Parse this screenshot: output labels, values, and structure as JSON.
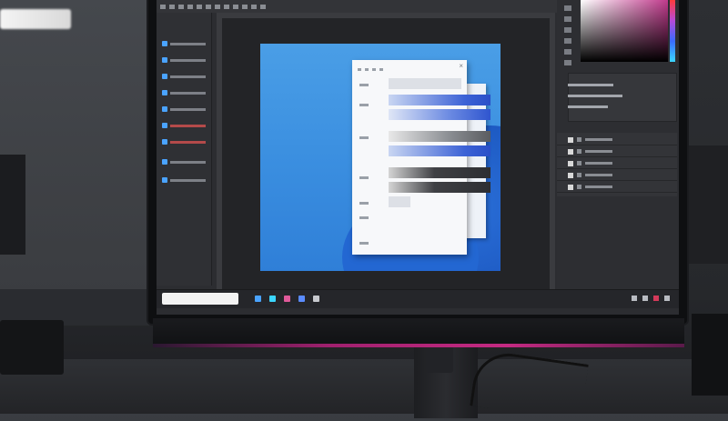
{
  "scene": {
    "description_tags": [
      "monitor",
      "photo-editor",
      "dark-room"
    ],
    "accent_colors": {
      "glow": "#c42a82",
      "artwork": "#3b8fe0",
      "slider_blue": "#3c62d6"
    }
  },
  "app": {
    "menubar_items": 12,
    "left_tools": [
      {
        "icon": "pointer-icon"
      },
      {
        "icon": "brush-icon"
      },
      {
        "icon": "layer-icon"
      },
      {
        "icon": "eraser-icon"
      },
      {
        "icon": "type-icon"
      },
      {
        "icon": "crop-icon"
      }
    ],
    "dialog": {
      "close_glyph": "×",
      "rows": [
        {
          "slider": "light"
        },
        {
          "slider": "blue"
        },
        {
          "slider": "blue2"
        },
        {
          "slider": "gray"
        },
        {
          "slider": "blue"
        },
        {
          "slider": "dark"
        },
        {
          "slider": "dark"
        },
        {
          "slider": "light"
        }
      ]
    },
    "layers": [
      {
        "name_icon": "layer-thumb-icon"
      },
      {
        "name_icon": "layer-thumb-icon"
      },
      {
        "name_icon": "layer-thumb-icon"
      },
      {
        "name_icon": "layer-thumb-icon"
      },
      {
        "name_icon": "layer-thumb-icon"
      }
    ]
  },
  "taskbar": {
    "icons": [
      {
        "name": "files-icon",
        "color": "#4aa3ff"
      },
      {
        "name": "browser-icon",
        "color": "#3bd6ff"
      },
      {
        "name": "store-icon",
        "color": "#e05a9a"
      },
      {
        "name": "mail-icon",
        "color": "#5a8cff"
      },
      {
        "name": "app-icon",
        "color": "#c7c9ce"
      }
    ]
  }
}
